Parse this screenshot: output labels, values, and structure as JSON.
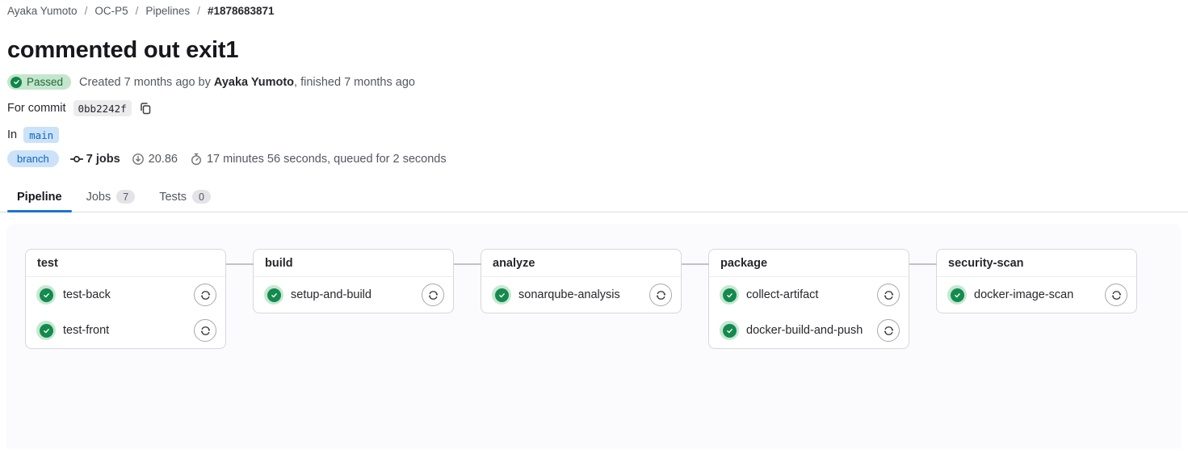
{
  "breadcrumb": {
    "separator": "/",
    "items": [
      "Ayaka Yumoto",
      "OC-P5",
      "Pipelines",
      "#1878683871"
    ]
  },
  "header": {
    "title": "commented out exit1",
    "status_badge": {
      "label": "Passed",
      "icon": "check-circle-icon"
    },
    "created_prefix": "Created 7 months ago by ",
    "author": "Ayaka Yumoto",
    "created_suffix": ", finished 7 months ago",
    "commit": {
      "label": "For commit",
      "sha": "0bb2242f",
      "copy_icon": "copy-icon"
    },
    "ref": {
      "label": "In",
      "branch": "main",
      "badge": "branch"
    },
    "stats": {
      "jobs_icon": "commit-icon",
      "jobs": "7 jobs",
      "compute_icon": "arrow-down-circle-icon",
      "compute": "20.86",
      "duration_icon": "stopwatch-icon",
      "duration": "17 minutes 56 seconds, queued for 2 seconds"
    }
  },
  "tabs": [
    {
      "label": "Pipeline",
      "active": true
    },
    {
      "label": "Jobs",
      "badge": "7"
    },
    {
      "label": "Tests",
      "badge": "0"
    }
  ],
  "pipeline": {
    "stages": [
      {
        "name": "test",
        "jobs": [
          {
            "name": "test-back",
            "status": "success"
          },
          {
            "name": "test-front",
            "status": "success"
          }
        ]
      },
      {
        "name": "build",
        "jobs": [
          {
            "name": "setup-and-build",
            "status": "success"
          }
        ]
      },
      {
        "name": "analyze",
        "jobs": [
          {
            "name": "sonarqube-analysis",
            "status": "success"
          }
        ]
      },
      {
        "name": "package",
        "jobs": [
          {
            "name": "collect-artifact",
            "status": "success"
          },
          {
            "name": "docker-build-and-push",
            "status": "success"
          }
        ]
      },
      {
        "name": "security-scan",
        "jobs": [
          {
            "name": "docker-image-scan",
            "status": "success"
          }
        ]
      }
    ],
    "job_action_icon": "retry-icon",
    "job_status_icon": "status-success-icon"
  },
  "colors": {
    "success_green": "#108548",
    "success_halo": "#c5e8d1",
    "passed_badge_bg": "#c3e6cd",
    "passed_badge_text": "#24663b",
    "ref_badge_bg": "#cbe2f9",
    "ref_badge_text": "#1068bf",
    "active_tab_underline": "#1f75cb",
    "panel_bg": "#fbfafd",
    "card_border": "#d8d7dc",
    "connector": "#c2c1c6"
  }
}
